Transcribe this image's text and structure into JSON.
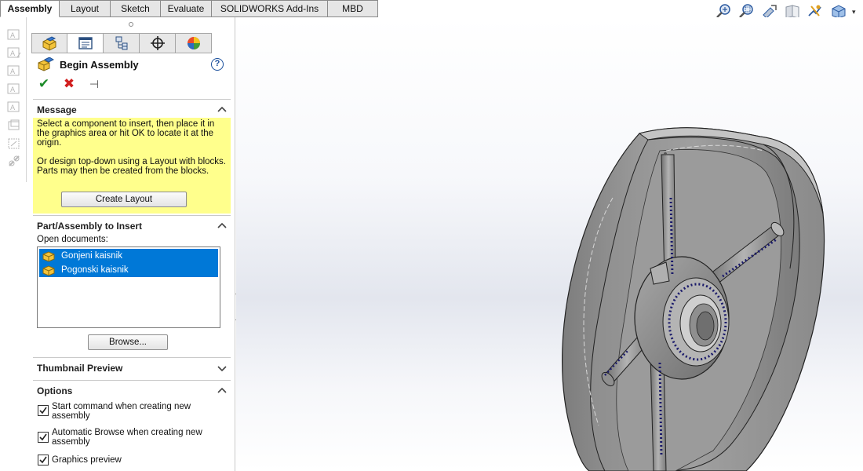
{
  "command_tabs": [
    "Assembly",
    "Layout",
    "Sketch",
    "Evaluate",
    "SOLIDWORKS Add-Ins",
    "MBD"
  ],
  "view_toolbar_icons": [
    "zoom-to-fit-icon",
    "zoom-to-area-icon",
    "previous-view-icon",
    "section-view-icon",
    "view-orientation-icon",
    "display-style-icon"
  ],
  "property_manager": {
    "tabs": [
      "feature-manager-icon",
      "property-manager-icon",
      "configuration-manager-icon",
      "dimxpert-icon",
      "display-manager-icon"
    ],
    "title": "Begin Assembly",
    "message": {
      "heading": "Message",
      "text1": "Select a component to insert, then place it in the graphics area or hit OK to locate it at the origin.",
      "text2": "Or design top-down using a Layout with blocks. Parts may then be created from the blocks.",
      "create_layout_label": "Create Layout"
    },
    "part_insert": {
      "heading": "Part/Assembly to Insert",
      "open_docs_label": "Open documents:",
      "documents": [
        "Gonjeni kaisnik",
        "Pogonski kaisnik"
      ],
      "browse_label": "Browse..."
    },
    "thumbnail": {
      "heading": "Thumbnail Preview"
    },
    "options": {
      "heading": "Options",
      "items": [
        {
          "label": "Start command when creating new assembly",
          "checked": true
        },
        {
          "label": "Automatic Browse when creating new assembly",
          "checked": true
        },
        {
          "label": "Graphics preview",
          "checked": true
        }
      ]
    }
  },
  "colors": {
    "message_bg": "#ffff8c",
    "selection": "#0078d7",
    "ok": "#1e8c2a",
    "cancel": "#d21f1f"
  }
}
